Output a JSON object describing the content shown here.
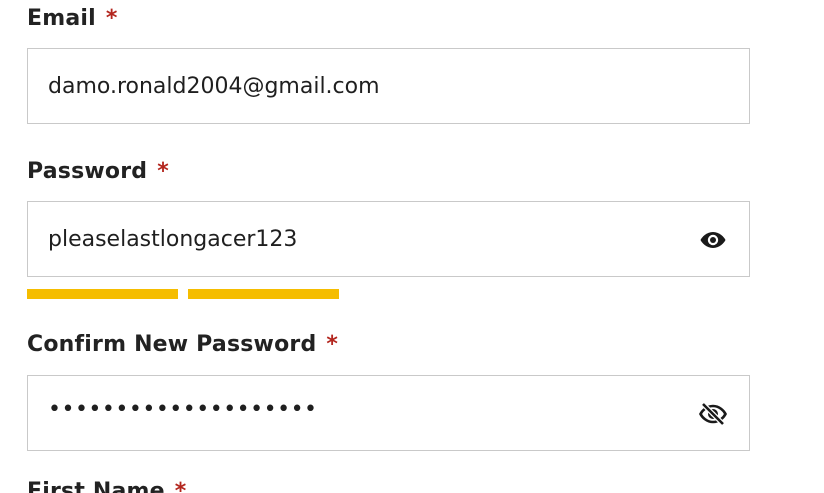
{
  "email": {
    "label": "Email",
    "required_mark": "*",
    "value": "damo.ronald2004@gmail.com"
  },
  "password": {
    "label": "Password",
    "required_mark": "*",
    "value": "pleaselastlongacer123",
    "toggle_icon": "eye-icon",
    "strength_segments_filled": 2,
    "strength_color": "#f5bd00"
  },
  "confirm_password": {
    "label": "Confirm New Password",
    "required_mark": "*",
    "masked_value": "••••••••••••••••••••",
    "toggle_icon": "eye-off-icon"
  },
  "first_name": {
    "label": "First Name",
    "required_mark": "*"
  },
  "colors": {
    "required": "#b3261e",
    "border": "#c9c9c9",
    "strength": "#f5bd00"
  }
}
